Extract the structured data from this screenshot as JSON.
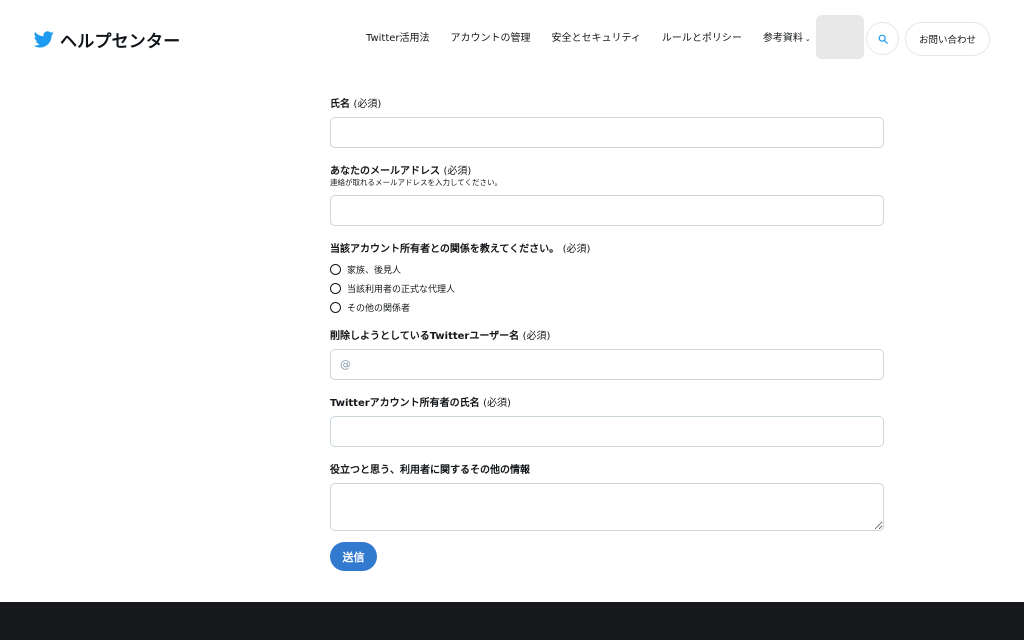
{
  "brand": {
    "title": "ヘルプセンター"
  },
  "nav": [
    {
      "label": "Twitter活用法"
    },
    {
      "label": "アカウントの管理"
    },
    {
      "label": "安全とセキュリティ"
    },
    {
      "label": "ルールとポリシー"
    },
    {
      "label": "参考資料"
    }
  ],
  "contact_label": "お問い合わせ",
  "form": {
    "name": {
      "label": "氏名",
      "required": "(必須)",
      "value": ""
    },
    "email": {
      "label": "あなたのメールアドレス",
      "required": "(必須)",
      "hint": "連絡が取れるメールアドレスを入力してください。",
      "value": ""
    },
    "relation": {
      "label": "当該アカウント所有者との関係を教えてください。",
      "required": "(必須)",
      "options": [
        "家族、後見人",
        "当該利用者の正式な代理人",
        "その他の関係者"
      ]
    },
    "username": {
      "label": "削除しようとしているTwitterユーザー名",
      "required": "(必須)",
      "placeholder": "@"
    },
    "owner_name": {
      "label": "Twitterアカウント所有者の氏名",
      "required": "(必須)",
      "value": ""
    },
    "other_info": {
      "label": "役立つと思う、利用者に関するその他の情報"
    },
    "submit_label": "送信"
  },
  "colors": {
    "accent": "#3279d0",
    "brand_bird": "#1d9bf0",
    "footer": "#16181c"
  }
}
